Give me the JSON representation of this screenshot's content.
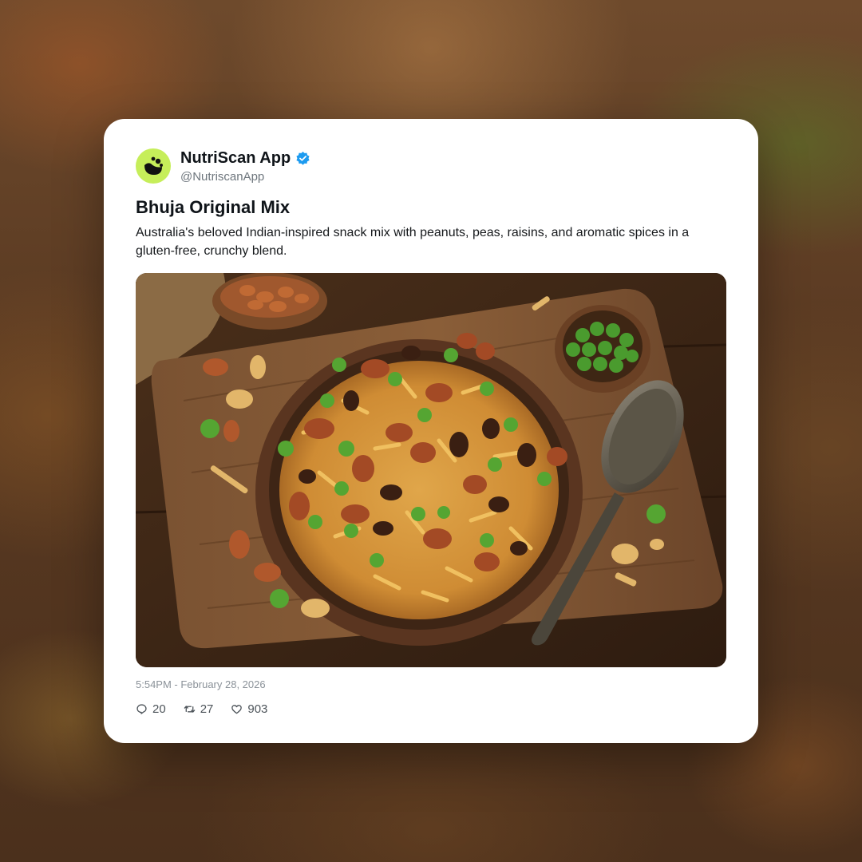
{
  "post": {
    "author": {
      "display_name": "NutriScan App",
      "handle": "@NutriscanApp",
      "verified": true,
      "avatar_icon": "nutriscan-logo-icon",
      "avatar_color": "#c6ee5a"
    },
    "title": "Bhuja Original Mix",
    "text": "Australia's beloved Indian-inspired snack mix with peanuts, peas, raisins, and aromatic spices in a gluten-free, crunchy blend.",
    "image": {
      "subject": "bowl of snack mix on wooden board"
    },
    "timestamp": "5:54PM - February 28, 2026",
    "stats": {
      "replies": "20",
      "reposts": "27",
      "likes": "903"
    }
  },
  "colors": {
    "verified_badge": "#1d9bf0",
    "avatar": "#c6ee5a"
  }
}
